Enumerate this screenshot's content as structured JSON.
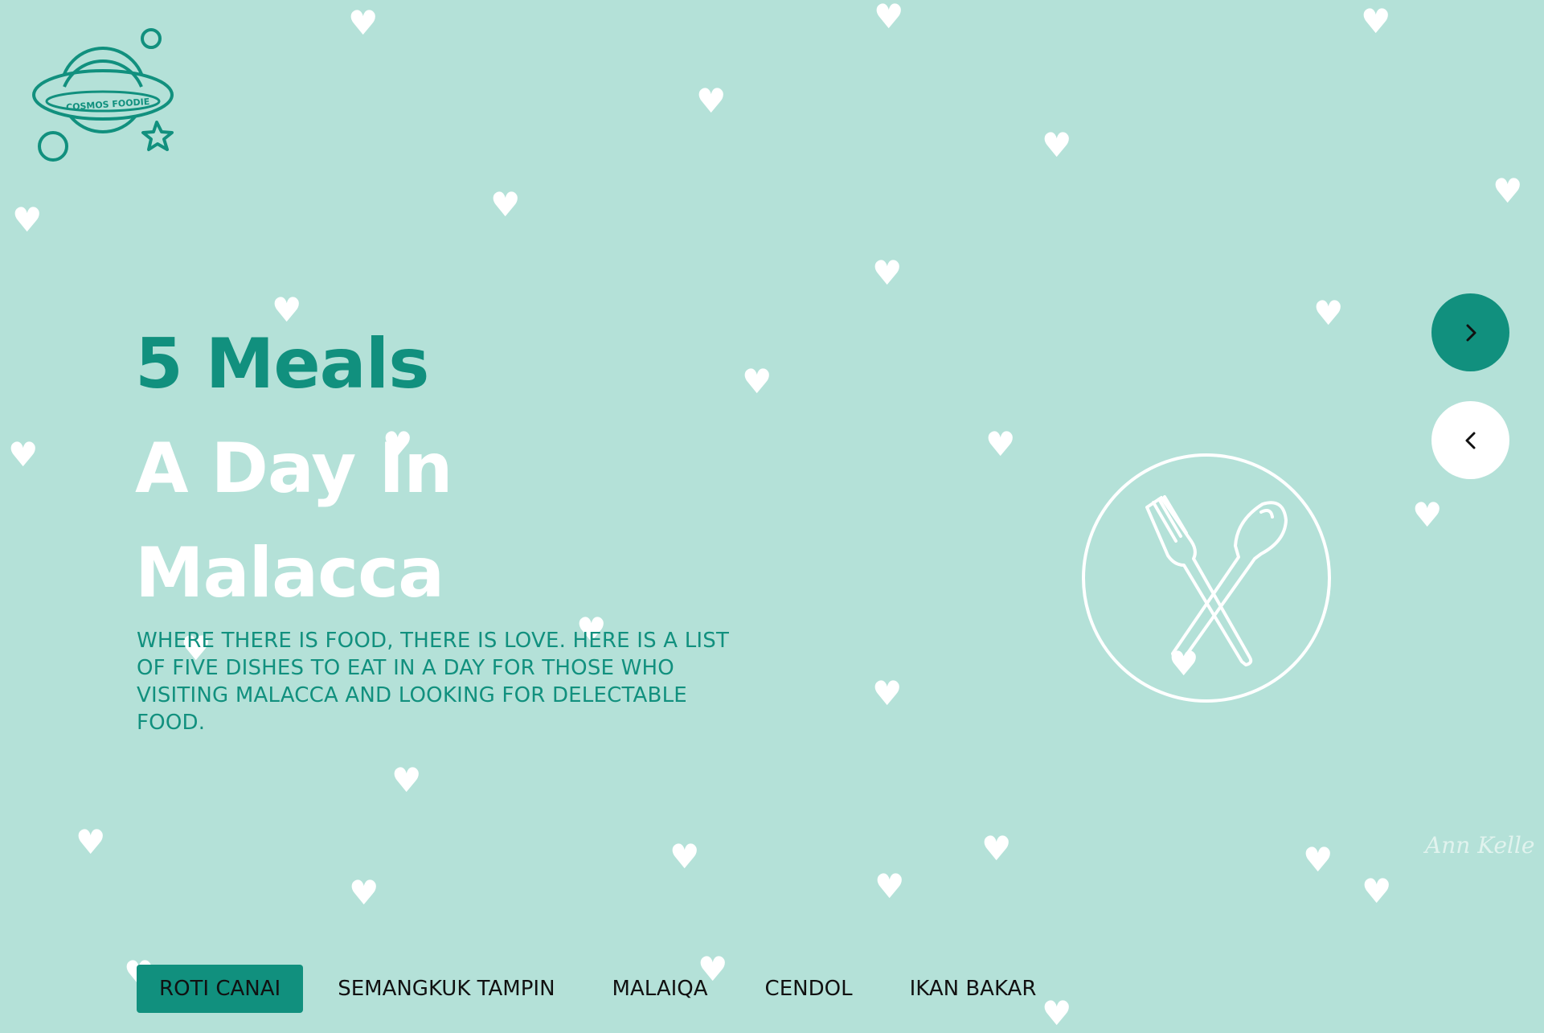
{
  "brand": {
    "logo_text": "COSMOS FOODIE"
  },
  "hero": {
    "title_line1": "5 Meals",
    "title_line2": "A Day In",
    "title_line3": "Malacca",
    "description": "WHERE THERE IS FOOD, THERE IS LOVE. HERE IS A LIST OF FIVE DISHES TO EAT IN A DAY FOR THOSE WHO VISITING MALACCA AND LOOKING FOR DELECTABLE FOOD."
  },
  "navigation": {
    "next_icon": "chevron-right-icon",
    "prev_icon": "chevron-left-icon"
  },
  "badge": {
    "icon": "fork-spoon-icon"
  },
  "signature": "Ann Kelle",
  "tabs": [
    {
      "label": "ROTI CANAI",
      "active": true
    },
    {
      "label": "SEMANGKUK TAMPIN",
      "active": false
    },
    {
      "label": "MALAIQA",
      "active": false
    },
    {
      "label": "CENDOL",
      "active": false
    },
    {
      "label": "IKAN BAKAR",
      "active": false
    }
  ],
  "colors": {
    "background": "#b4e1d8",
    "accent": "#11907e",
    "white": "#ffffff"
  }
}
